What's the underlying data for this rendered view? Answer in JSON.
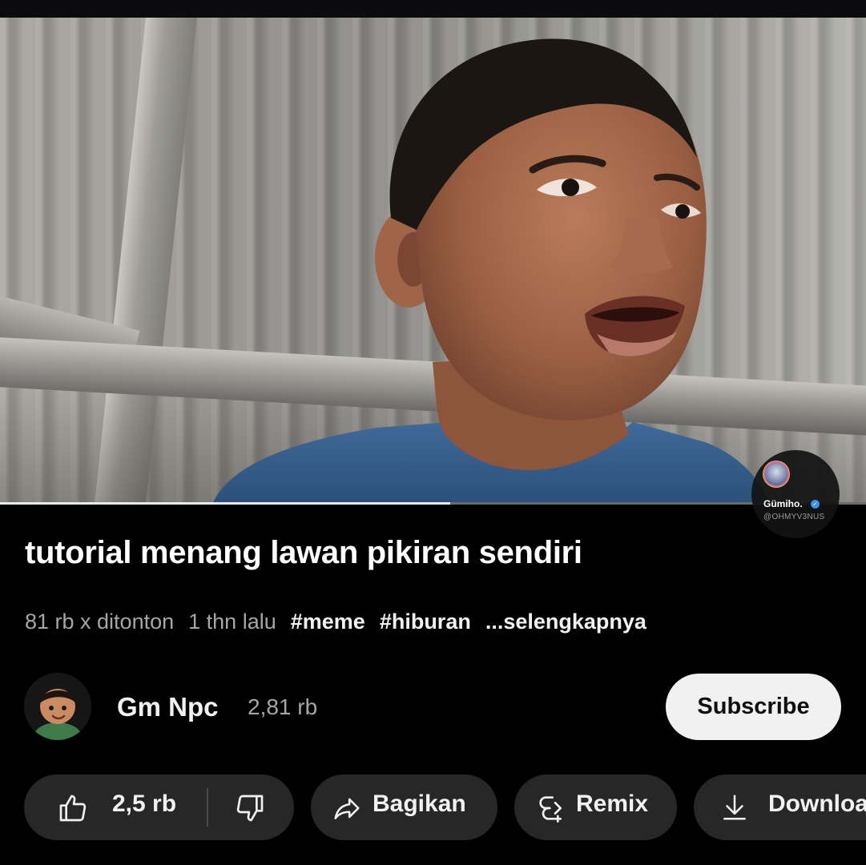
{
  "video": {
    "title": "tutorial menang lawan pikiran sendiri",
    "progress_fraction": 0.52
  },
  "watermark": {
    "name": "Gümiho.",
    "handle": "@OHMYV3NUS"
  },
  "meta": {
    "views": "81 rb x ditonton",
    "age": "1 thn lalu",
    "tags": [
      "#meme",
      "#hiburan"
    ],
    "more": "...selengkapnya"
  },
  "channel": {
    "name": "Gm Npc",
    "subscribers": "2,81 rb",
    "subscribe_label": "Subscribe"
  },
  "actions": {
    "likes": "2,5 rb",
    "share_label": "Bagikan",
    "remix_label": "Remix",
    "download_label": "Download"
  },
  "colors": {
    "background": "#000000",
    "pill": "#272727",
    "subscribe_bg": "#f1f1f1",
    "meta_text": "#a6a6a6",
    "verified": "#3b8ff0"
  },
  "icons": [
    "like-icon",
    "dislike-icon",
    "share-icon",
    "remix-icon",
    "download-icon",
    "verified-icon"
  ]
}
